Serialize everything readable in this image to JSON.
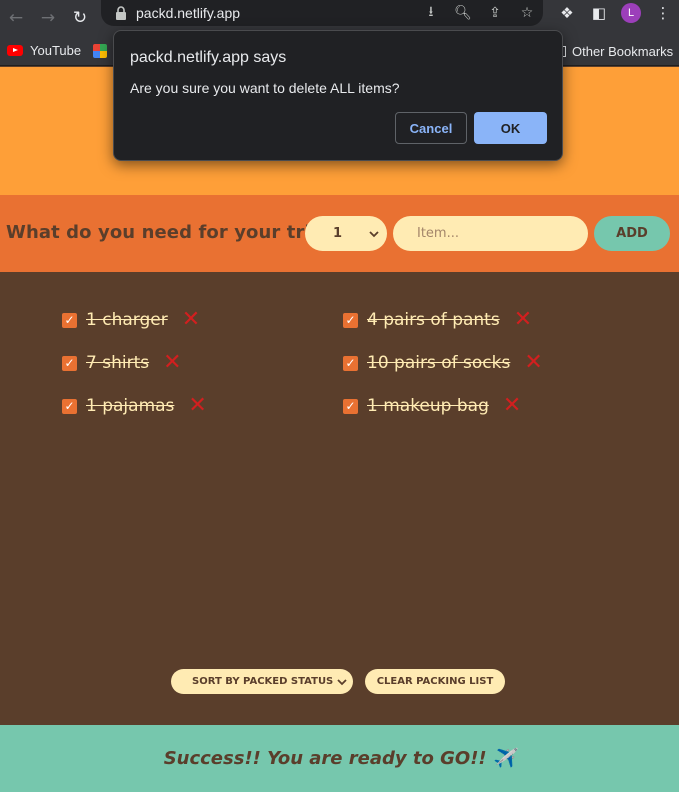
{
  "browser": {
    "url": "packd.netlify.app",
    "avatar_letter": "L",
    "bookmarks": [
      {
        "label": "YouTube"
      }
    ],
    "other_bookmarks": "Other Bookmarks"
  },
  "dialog": {
    "title": "packd.netlify.app says",
    "message": "Are you sure you want to delete ALL items?",
    "cancel_label": "Cancel",
    "ok_label": "OK"
  },
  "form": {
    "title": "What do you need for your trip?",
    "quantity_value": "1",
    "item_placeholder": "Item...",
    "add_label": "ADD"
  },
  "items": [
    {
      "label": "1 charger",
      "packed": true
    },
    {
      "label": "4 pairs of pants",
      "packed": true
    },
    {
      "label": "7 shirts",
      "packed": true
    },
    {
      "label": "10 pairs of socks",
      "packed": true
    },
    {
      "label": "1 pajamas",
      "packed": true
    },
    {
      "label": "1 makeup bag",
      "packed": true
    }
  ],
  "actions": {
    "sort_value": "SORT BY PACKED STATUS",
    "clear_label": "CLEAR PACKING LIST"
  },
  "footer": {
    "message": "Success!! You are ready to GO!! ✈️"
  },
  "colors": {
    "header": "#fe9f38",
    "form_bar": "#e97132",
    "list_bg": "#5a3e2b",
    "footer": "#76c7ad",
    "cream": "#ffebb3",
    "delete": "#d21f1f"
  }
}
